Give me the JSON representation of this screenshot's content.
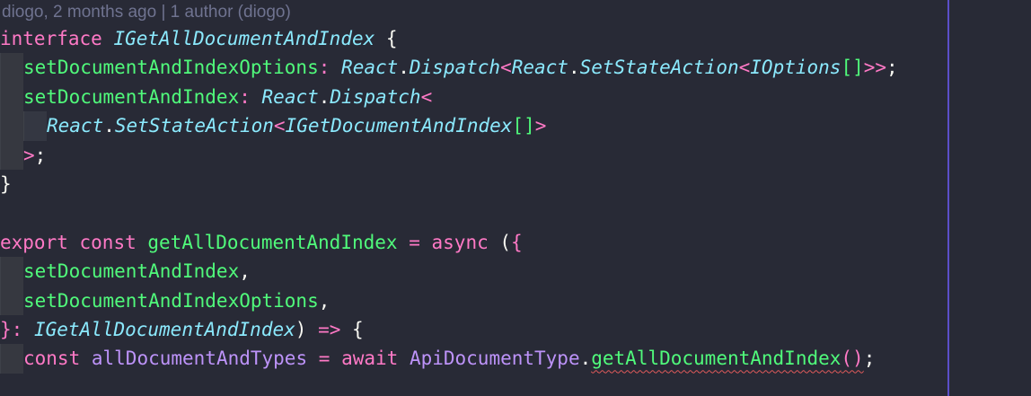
{
  "blame": {
    "text": "diogo, 2 months ago | 1 author (diogo)"
  },
  "colors": {
    "background": "#282a36",
    "keyword": "#ff79c6",
    "type": "#8be9fd",
    "property": "#50fa7b",
    "foreground": "#f8f8f2",
    "blame": "#6f7390",
    "error_squiggle": "#e05a5a",
    "ruler": "#5b4fc9"
  },
  "code": {
    "l1": {
      "kw": "interface",
      "name": "IGetAllDocumentAndIndex",
      "brace": "{"
    },
    "l2": {
      "prop": "setDocumentAndIndexOptions",
      "colon": ":",
      "react1": "React",
      "dot1": ".",
      "dispatch": "Dispatch",
      "lt1": "<",
      "react2": "React",
      "dot2": ".",
      "ssa": "SetStateAction",
      "lt2": "<",
      "ioptions": "IOptions",
      "arr": "[]",
      "gt": ">>",
      "semi": ";"
    },
    "l3": {
      "prop": "setDocumentAndIndex",
      "colon": ":",
      "react": "React",
      "dot": ".",
      "dispatch": "Dispatch",
      "lt": "<"
    },
    "l4": {
      "react": "React",
      "dot": ".",
      "ssa": "SetStateAction",
      "lt": "<",
      "name": "IGetDocumentAndIndex",
      "arr": "[]",
      "gt": ">"
    },
    "l5": {
      "gt": ">",
      "semi": ";"
    },
    "l6": {
      "brace": "}"
    },
    "l8": {
      "export": "export",
      "const": "const",
      "name": "getAllDocumentAndIndex",
      "eq": "=",
      "async": "async",
      "paren": "(",
      "brace": "{"
    },
    "l9": {
      "name": "setDocumentAndIndex",
      "comma": ","
    },
    "l10": {
      "name": "setDocumentAndIndexOptions",
      "comma": ","
    },
    "l11": {
      "brace": "}",
      "colon": ":",
      "type": "IGetAllDocumentAndIndex",
      "paren": ")",
      "arrow": "=>",
      "open": "{"
    },
    "l12": {
      "const": "const",
      "name": "allDocumentAndTypes",
      "eq": "=",
      "await": "await",
      "obj": "ApiDocumentType",
      "dot": ".",
      "method": "getAllDocumentAndIndex",
      "call": "()",
      "semi": ";"
    }
  }
}
